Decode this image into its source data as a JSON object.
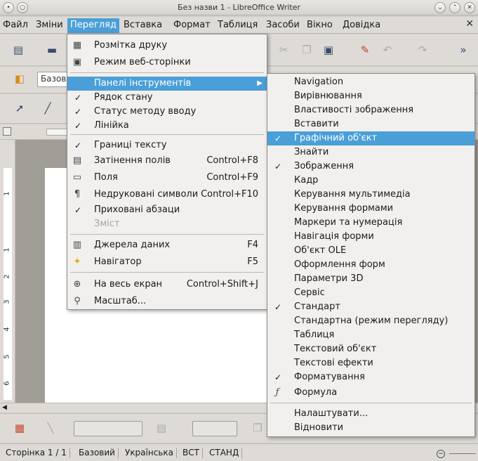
{
  "window": {
    "title": "Без назви 1 - LibreOffice Writer"
  },
  "menubar": {
    "items": [
      "Файл",
      "Зміни",
      "Перегляд",
      "Вставка",
      "Формат",
      "Таблиця",
      "Засоби",
      "Вікно",
      "Довідка"
    ],
    "active_index": 2
  },
  "toolbar": {
    "style_combo": "Базов"
  },
  "view_menu": {
    "items": [
      {
        "label": "Розмітка друку",
        "icon": "print-layout-icon",
        "checked": false,
        "shortcut": ""
      },
      {
        "label": "Режим веб-сторінки",
        "icon": "web-layout-icon",
        "checked": false,
        "shortcut": ""
      },
      {
        "label": "Панелі інструментів",
        "submenu": true,
        "highlighted": true
      },
      {
        "label": "Рядок стану",
        "checked": true
      },
      {
        "label": "Статус методу вводу",
        "checked": true
      },
      {
        "label": "Лінійка",
        "checked": true
      },
      {
        "label": "Границі тексту",
        "checked": true
      },
      {
        "label": "Затінення полів",
        "icon": "field-shading-icon",
        "shortcut": "Control+F8"
      },
      {
        "label": "Поля",
        "icon": "fields-icon",
        "shortcut": "Control+F9"
      },
      {
        "label": "Недруковані символи",
        "icon": "pilcrow-icon",
        "shortcut": "Control+F10"
      },
      {
        "label": "Приховані абзаци",
        "checked": true
      },
      {
        "label": "Зміст",
        "disabled": true
      },
      {
        "label": "Джерела даних",
        "icon": "data-sources-icon",
        "shortcut": "F4"
      },
      {
        "label": "Навігатор",
        "icon": "navigator-icon",
        "shortcut": "F5"
      },
      {
        "label": "На весь екран",
        "icon": "fullscreen-icon",
        "shortcut": "Control+Shift+J"
      },
      {
        "label": "Масштаб...",
        "icon": "zoom-icon"
      }
    ]
  },
  "toolbars_submenu": {
    "items": [
      {
        "label": "Navigation"
      },
      {
        "label": "Вирівнювання"
      },
      {
        "label": "Властивості зображення"
      },
      {
        "label": "Вставити"
      },
      {
        "label": "Графічний об'єкт",
        "checked": true,
        "highlighted": true
      },
      {
        "label": "Знайти"
      },
      {
        "label": "Зображення",
        "checked": true
      },
      {
        "label": "Кадр"
      },
      {
        "label": "Керування мультимедіа"
      },
      {
        "label": "Керування формами"
      },
      {
        "label": "Маркери та нумерація"
      },
      {
        "label": "Навігація форми"
      },
      {
        "label": "Об'єкт OLE"
      },
      {
        "label": "Оформлення форм"
      },
      {
        "label": "Параметри 3D"
      },
      {
        "label": "Сервіс"
      },
      {
        "label": "Стандарт",
        "checked": true
      },
      {
        "label": "Стандартна (режим перегляду)"
      },
      {
        "label": "Таблиця"
      },
      {
        "label": "Текстовий об'єкт"
      },
      {
        "label": "Текстові ефекти"
      },
      {
        "label": "Форматування",
        "checked": true
      },
      {
        "label": "Формула",
        "icon": "formula-icon"
      },
      {
        "label": "Налаштувати..."
      },
      {
        "label": "Відновити"
      }
    ]
  },
  "statusbar": {
    "page": "Сторінка 1 / 1",
    "style": "Базовий",
    "language": "Українська",
    "insert_mode": "ВСТ",
    "selection_mode": "СТАНД"
  },
  "ruler_numbers": [
    "1",
    "1",
    "2",
    "3",
    "4",
    "5",
    "6"
  ]
}
